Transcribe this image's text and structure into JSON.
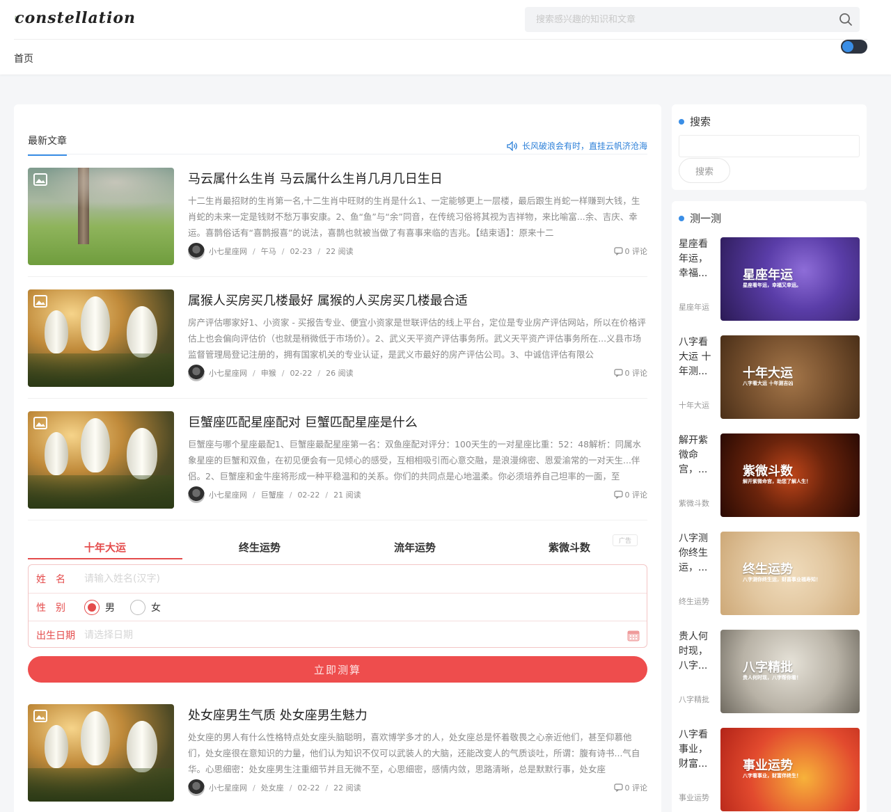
{
  "header": {
    "logo_text": "constellation",
    "search_placeholder": "搜索感兴趣的知识和文章",
    "nav_home": "首页"
  },
  "main": {
    "section_title": "最新文章",
    "notice": "长风破浪会有时，直挂云帆济沧海",
    "articles": [
      {
        "title": "马云属什么生肖 马云属什么生肖几月几日生日",
        "excerpt": "十二生肖最招财的生肖第一名,十二生肖中旺财的生肖是什么1、一定能够更上一层楼，最后跟生肖蛇一样赚到大钱，生肖蛇的未来一定是钱财不愁万事安康。2、鱼“鱼”与“余”同音，在传统习俗将其视为吉祥物，来比喻富...余、吉庆、幸运。喜鹊俗话有“喜鹊报喜”的说法，喜鹊也就被当做了有喜事来临的吉兆。【结束语】：原来十二",
        "author": "小七星座网",
        "category": "午马",
        "date": "02-23",
        "reads": "22 阅读",
        "comments": "0 评论"
      },
      {
        "title": "属猴人买房买几楼最好 属猴的人买房买几楼最合适",
        "excerpt": "房产评估哪家好1、小资家 - 买报告专业、便宜小资家是世联评估的线上平台，定位是专业房产评估网站，所以在价格评估上也会偏向评估价（也就是稍微低于市场价）。2、武义天平资产评估事务所。武义天平资产评估事务所在...义县市场监督管理局登记注册的，拥有国家机关的专业认证，是武义市最好的房产评估公司。3、中诚信评估有限公",
        "author": "小七星座网",
        "category": "申猴",
        "date": "02-22",
        "reads": "26 阅读",
        "comments": "0 评论"
      },
      {
        "title": "巨蟹座匹配星座配对 巨蟹匹配星座是什么",
        "excerpt": "巨蟹座与哪个星座最配1、巨蟹座最配星座第一名：双鱼座配对评分：100天生的一对星座比重：52：48解析：同属水象星座的巨蟹和双鱼，在初见便会有一见倾心的感受，互相相吸引而心意交融，是浪漫绵密、恩爱渝常的一对天生...伴侣。2、巨蟹座和金牛座将形成一种平稳温和的关系。你们的共同点是心地温柔。你必须培养自己坦率的一面，至",
        "author": "小七星座网",
        "category": "巨蟹座",
        "date": "02-22",
        "reads": "21 阅读",
        "comments": "0 评论"
      },
      {
        "title": "处女座男生气质 处女座男生魅力",
        "excerpt": "处女座的男人有什么性格特点处女座头脑聪明，喜欢博学多才的人，处女座总是怀着敬畏之心亲近他们，甚至仰慕他们，处女座很在意知识的力量，他们认为知识不仅可以武装人的大脑，还能改变人的气质谈吐，所谓：腹有诗书...气自华。心思细密：处女座男生注重细节并且无微不至，心思细密，感情内敛，思路清晰，总是默默行事，处女座",
        "author": "小七星座网",
        "category": "处女座",
        "date": "02-22",
        "reads": "22 阅读",
        "comments": "0 评论"
      }
    ],
    "fortune": {
      "tabs": [
        "十年大运",
        "终生运势",
        "流年运势",
        "紫微斗数"
      ],
      "ad_label": "广告",
      "name_label": "姓　名",
      "name_placeholder": "请输入姓名(汉字)",
      "gender_label": "性　别",
      "male": "男",
      "female": "女",
      "birth_label": "出生日期",
      "birth_placeholder": "请选择日期",
      "submit": "立即测算"
    }
  },
  "sidebar": {
    "search_title": "搜索",
    "search_button": "搜索",
    "test_title": "测一测",
    "tests": [
      {
        "text": "星座看年运，幸福...",
        "category": "星座年运",
        "banner_title": "星座年运",
        "banner_sub": "星座看年运，幸福又幸运。",
        "color": "#4a2f86"
      },
      {
        "text": "八字看大运 十年测...",
        "category": "十年大运",
        "banner_title": "十年大运",
        "banner_sub": "八字看大运 十年测吉凶",
        "color": "#7a5330"
      },
      {
        "text": "解开紫微命宫，...",
        "category": "紫微斗数",
        "banner_title": "紫微斗数",
        "banner_sub": "解开紫微命宫，助您了解人生！",
        "color": "#3a1608"
      },
      {
        "text": "八字测你终生运，...",
        "category": "终生运势",
        "banner_title": "终生运势",
        "banner_sub": "八字测你终生运，财喜事业福寿知！",
        "color": "#e2c7a0"
      },
      {
        "text": "贵人何时现，八字...",
        "category": "八字精批",
        "banner_title": "八字精批",
        "banner_sub": "贵人何时现，八字帮你看！",
        "color": "#b8b2a6"
      },
      {
        "text": "八字看事业，财富...",
        "category": "事业运势",
        "banner_title": "事业运势",
        "banner_sub": "八字看事业，财富伴终生！",
        "color": "#e24a2e"
      }
    ]
  }
}
